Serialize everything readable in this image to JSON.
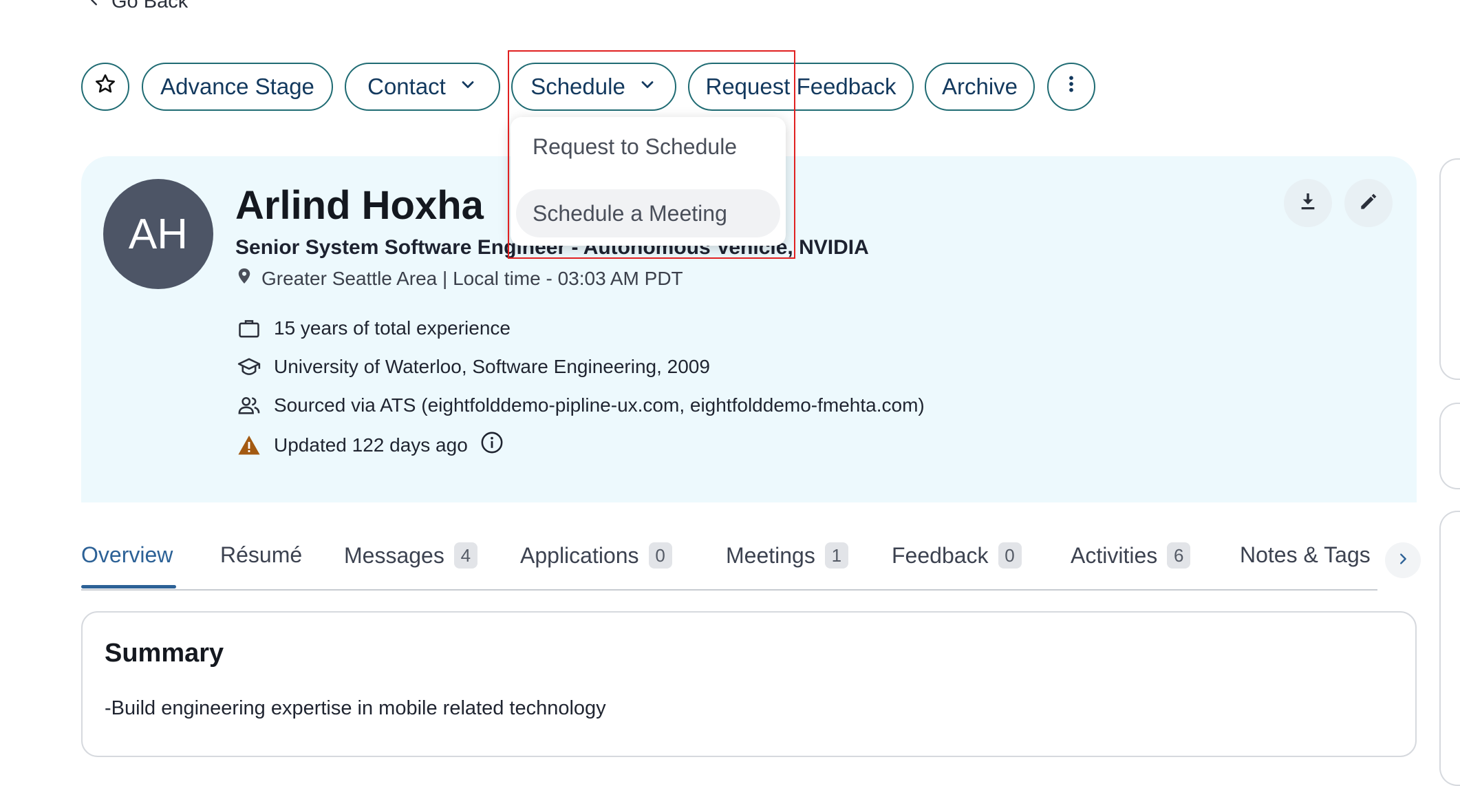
{
  "nav": {
    "go_back_label": "Go Back"
  },
  "toolbar": {
    "star_icon": "star-icon",
    "advance_stage_label": "Advance Stage",
    "contact_label": "Contact",
    "schedule_label": "Schedule",
    "request_feedback_label": "Request Feedback",
    "archive_label": "Archive",
    "more_icon": "more-vertical-icon"
  },
  "schedule_menu": {
    "items": [
      {
        "label": "Request to Schedule"
      },
      {
        "label": "Schedule a Meeting"
      }
    ]
  },
  "profile": {
    "initials": "AH",
    "name": "Arlind Hoxha",
    "title": "Senior System Software Engineer - Autonomous Vehicle, NVIDIA",
    "location": "Greater Seattle Area | Local time - 03:03 AM PDT",
    "experience": "15 years of total experience",
    "education": "University of Waterloo, Software Engineering, 2009",
    "source": "Sourced via ATS (eightfolddemo-pipline-ux.com, eightfolddemo-fmehta.com)",
    "updated": "Updated 122 days ago"
  },
  "tabs": [
    {
      "label": "Overview",
      "count": ""
    },
    {
      "label": "Résumé",
      "count": ""
    },
    {
      "label": "Messages",
      "count": "4"
    },
    {
      "label": "Applications",
      "count": "0"
    },
    {
      "label": "Meetings",
      "count": "1"
    },
    {
      "label": "Feedback",
      "count": "0"
    },
    {
      "label": "Activities",
      "count": "6"
    },
    {
      "label": "Notes & Tags",
      "count": ""
    }
  ],
  "summary": {
    "title": "Summary",
    "text": "-Build engineering expertise in mobile related technology"
  },
  "colors": {
    "accent": "#2c6196",
    "pill_border": "#1f6b73",
    "card_bg": "#edf9fd",
    "warning": "#a35a12"
  }
}
